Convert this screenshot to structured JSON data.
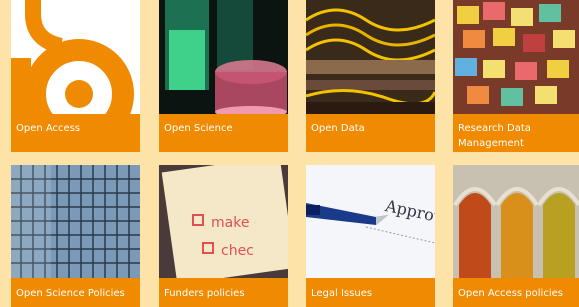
{
  "tiles": [
    {
      "label": "Open Access",
      "icon": "open-access-lock-icon"
    },
    {
      "label": "Open Science",
      "icon": "lab-glassware-image"
    },
    {
      "label": "Open Data",
      "icon": "network-cables-image"
    },
    {
      "label": "Research Data Management",
      "icon": "sticky-notes-image"
    },
    {
      "label": "Open Science Policies",
      "icon": "building-facade-image"
    },
    {
      "label": "Funders policies",
      "icon": "checklist-notepad-image"
    },
    {
      "label": "Legal Issues",
      "icon": "pen-approval-document-image"
    },
    {
      "label": "Open Access policies",
      "icon": "arched-doors-image"
    }
  ],
  "colors": {
    "accent": "#f08a00",
    "background": "#fde3a8",
    "label_text": "#ffffff"
  }
}
